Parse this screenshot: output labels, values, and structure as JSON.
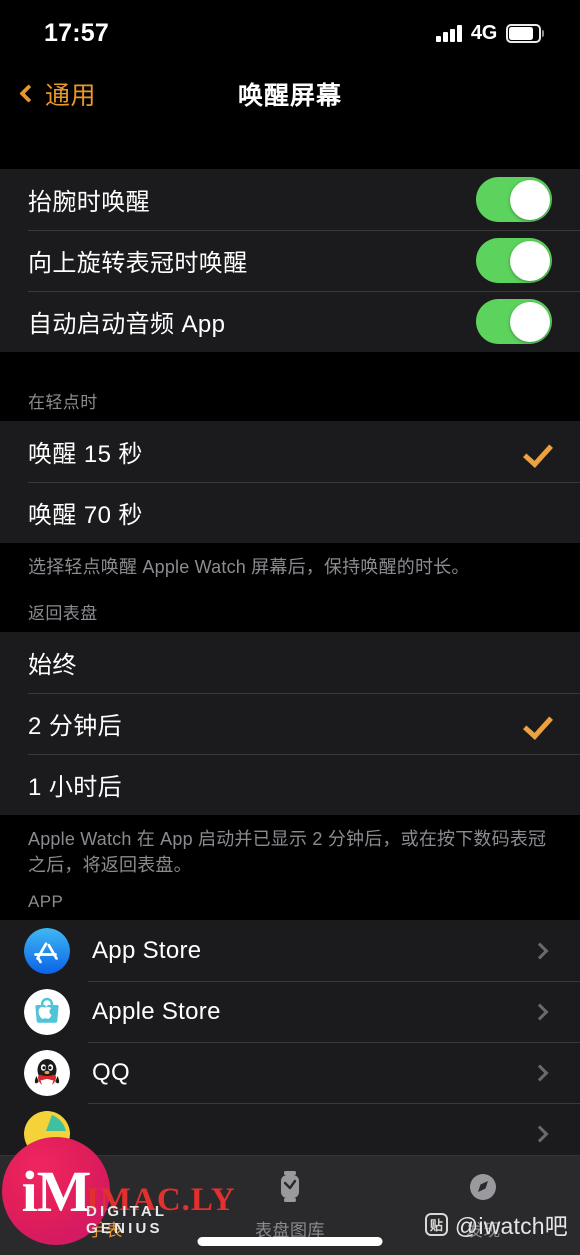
{
  "status_bar": {
    "time": "17:57",
    "network": "4G",
    "signal_bars": 4,
    "battery_level": 75
  },
  "nav": {
    "back_label": "通用",
    "title": "唤醒屏幕"
  },
  "toggles": [
    {
      "label": "抬腕时唤醒",
      "on": true
    },
    {
      "label": "向上旋转表冠时唤醒",
      "on": true
    },
    {
      "label": "自动启动音频 App",
      "on": true
    }
  ],
  "tap_section": {
    "header": "在轻点时",
    "options": [
      {
        "label": "唤醒 15 秒",
        "checked": true
      },
      {
        "label": "唤醒 70 秒",
        "checked": false
      }
    ],
    "footer": "选择轻点唤醒 Apple Watch 屏幕后，保持唤醒的时长。"
  },
  "return_section": {
    "header": "返回表盘",
    "options": [
      {
        "label": "始终",
        "checked": false
      },
      {
        "label": "2 分钟后",
        "checked": true
      },
      {
        "label": "1 小时后",
        "checked": false
      }
    ],
    "footer": "Apple Watch 在 App 启动并已显示 2 分钟后，或在按下数码表冠之后，将返回表盘。"
  },
  "app_section": {
    "header": "APP",
    "apps": [
      {
        "label": "App Store",
        "icon": "app-store-icon"
      },
      {
        "label": "Apple Store",
        "icon": "apple-store-icon"
      },
      {
        "label": "QQ",
        "icon": "qq-icon"
      }
    ]
  },
  "tabbar": {
    "tabs": [
      {
        "label": "的手表",
        "icon": "watch-icon",
        "selected": true
      },
      {
        "label": "表盘图库",
        "icon": "watch-face-gallery-icon",
        "selected": false
      },
      {
        "label": "发现",
        "icon": "compass-icon",
        "selected": false
      }
    ]
  },
  "watermarks": {
    "imac_mark": "iM",
    "imac_name": "IMAC.LY",
    "imac_tagline": "DIGITAL GENIUS",
    "tieba_glyph": "贴",
    "tieba_handle": "@iwatch吧"
  },
  "colors": {
    "accent_orange": "#E8972B",
    "check_orange": "#EFA23C",
    "toggle_green": "#5CD35C",
    "row_bg": "#1B1B1D",
    "page_bg": "#000000",
    "separator": "#39393B",
    "secondary_text": "#8B8B90"
  }
}
